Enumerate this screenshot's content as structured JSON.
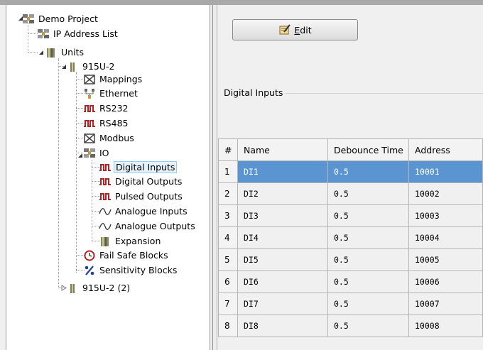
{
  "tree": {
    "root": "Demo Project",
    "ip_address_list": "IP Address List",
    "units": "Units",
    "unit1": "915U-2",
    "mappings": "Mappings",
    "ethernet": "Ethernet",
    "rs232": "RS232",
    "rs485": "RS485",
    "modbus": "Modbus",
    "io": "IO",
    "digital_inputs": "Digital Inputs",
    "digital_outputs": "Digital Outputs",
    "pulsed_outputs": "Pulsed Outputs",
    "analogue_inputs": "Analogue Inputs",
    "analogue_outputs": "Analogue Outputs",
    "expansion": "Expansion",
    "fail_safe_blocks": "Fail Safe Blocks",
    "sensitivity_blocks": "Sensitivity Blocks",
    "unit2": "915U-2 (2)"
  },
  "toolbar": {
    "edit_label_first": "E",
    "edit_label_rest": "dit"
  },
  "group": {
    "label": "Digital Inputs"
  },
  "grid": {
    "headers": [
      "#",
      "Name",
      "Debounce Time",
      "Address"
    ],
    "rows": [
      [
        "1",
        "DI1",
        "0.5",
        "10001"
      ],
      [
        "2",
        "DI2",
        "0.5",
        "10002"
      ],
      [
        "3",
        "DI3",
        "0.5",
        "10003"
      ],
      [
        "4",
        "DI4",
        "0.5",
        "10004"
      ],
      [
        "5",
        "DI5",
        "0.5",
        "10005"
      ],
      [
        "6",
        "DI6",
        "0.5",
        "10006"
      ],
      [
        "7",
        "DI7",
        "0.5",
        "10007"
      ],
      [
        "8",
        "DI8",
        "0.5",
        "10008"
      ]
    ],
    "selected_row": 0
  },
  "colors": {
    "selection": "#5b95d1",
    "tree_selection": "#e5f1fb"
  },
  "icons": {
    "root": "network-icon",
    "ip_address_list": "network-icon",
    "units": "device-icon",
    "unit": "device-icon",
    "mappings": "mappings-icon",
    "ethernet": "ethernet-icon",
    "serial": "serial-port-icon",
    "io": "network-icon",
    "digital": "digital-io-icon",
    "analogue": "analogue-wave-icon",
    "expansion": "expansion-icon",
    "fail_safe": "clock-icon",
    "sensitivity": "percent-icon"
  }
}
